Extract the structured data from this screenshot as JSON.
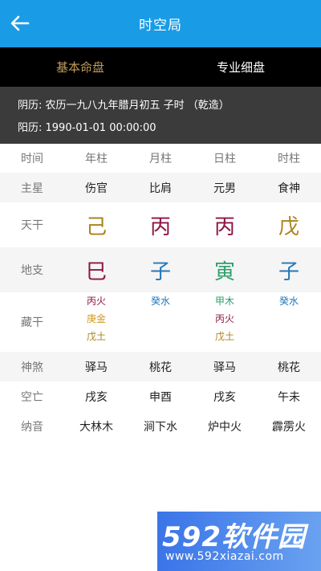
{
  "header": {
    "title": "时空局"
  },
  "tabs": [
    {
      "label": "基本命盘",
      "active": true
    },
    {
      "label": "专业细盘",
      "active": false
    }
  ],
  "info": {
    "lunar": "阴历: 农历一九八九年腊月初五   子时 （乾造）",
    "solar": "阳历: 1990-01-01 00:00:00"
  },
  "table": {
    "header_row": {
      "label": "时间",
      "cols": [
        "年柱",
        "月柱",
        "日柱",
        "时柱"
      ]
    },
    "zhuxing": {
      "label": "主星",
      "cols": [
        "伤官",
        "比肩",
        "元男",
        "食神"
      ]
    },
    "tiangan": {
      "label": "天干",
      "cols": [
        {
          "text": "己",
          "color": "#a8851f"
        },
        {
          "text": "丙",
          "color": "#8e1545"
        },
        {
          "text": "丙",
          "color": "#8e1545"
        },
        {
          "text": "戊",
          "color": "#a8851f"
        }
      ]
    },
    "dizhi": {
      "label": "地支",
      "cols": [
        {
          "text": "巳",
          "color": "#8e1545"
        },
        {
          "text": "子",
          "color": "#2378b8"
        },
        {
          "text": "寅",
          "color": "#2e9e6e"
        },
        {
          "text": "子",
          "color": "#2378b8"
        }
      ]
    },
    "canggan": {
      "label": "藏干",
      "cols": [
        [
          {
            "text": "丙火",
            "color": "#8e1545"
          },
          {
            "text": "庚金",
            "color": "#d19a1a"
          },
          {
            "text": "戊土",
            "color": "#a8851f"
          }
        ],
        [
          {
            "text": "癸水",
            "color": "#2378b8"
          }
        ],
        [
          {
            "text": "甲木",
            "color": "#2e9e6e"
          },
          {
            "text": "丙火",
            "color": "#8e1545"
          },
          {
            "text": "戊土",
            "color": "#a8851f"
          }
        ],
        [
          {
            "text": "癸水",
            "color": "#2378b8"
          }
        ]
      ]
    },
    "shensha": {
      "label": "神煞",
      "cols": [
        "驿马",
        "桃花",
        "驿马",
        "桃花"
      ]
    },
    "kongwang": {
      "label": "空亡",
      "cols": [
        "戌亥",
        "申酉",
        "戌亥",
        "午未"
      ]
    },
    "nayin": {
      "label": "纳音",
      "cols": [
        "大林木",
        "涧下水",
        "炉中火",
        "霹雳火"
      ]
    }
  },
  "watermark": {
    "logo": "592软件园",
    "url": "www.592xiazai.com"
  }
}
